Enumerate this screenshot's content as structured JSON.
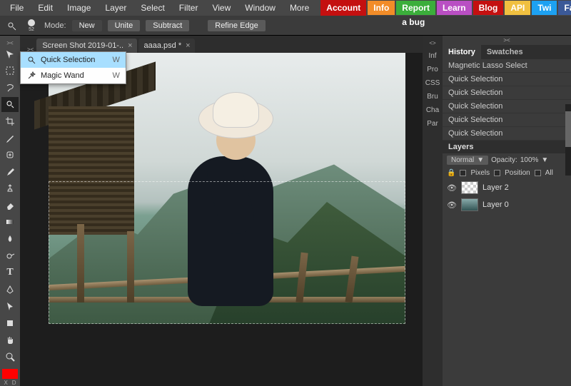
{
  "menubar": {
    "items": [
      "File",
      "Edit",
      "Image",
      "Layer",
      "Select",
      "Filter",
      "View",
      "Window",
      "More"
    ],
    "account": "Account"
  },
  "pills": {
    "info": "Info",
    "bug": "Report a bug",
    "learn": "Learn",
    "blog": "Blog",
    "api": "API",
    "twi": "Twi",
    "fb": "Facebook"
  },
  "options": {
    "brush_size": "52",
    "mode": "Mode:",
    "new": "New",
    "unite": "Unite",
    "subtract": "Subtract",
    "refine": "Refine Edge"
  },
  "tabs": {
    "t1": "Screen Shot 2019-01-..",
    "t2": "aaaa.psd *"
  },
  "flyout": {
    "opt1": "Quick Selection",
    "opt2": "Magic Wand",
    "k": "W"
  },
  "midtabs": {
    "t1": "Inf",
    "t2": "Pro",
    "t3": "CSS",
    "t4": "Bru",
    "t5": "Cha",
    "t6": "Par"
  },
  "rpanel": {
    "tab_history": "History",
    "tab_swatches": "Swatches",
    "hist": [
      "Magnetic Lasso Select",
      "Quick Selection",
      "Quick Selection",
      "Quick Selection",
      "Quick Selection",
      "Quick Selection"
    ],
    "layers_label": "Layers",
    "blend": "Normal",
    "opacity_label": "Opacity:",
    "opacity_val": "100%",
    "lock_pixels": "Pixels",
    "lock_position": "Position",
    "lock_all": "All",
    "layer1_name": "Layer 2",
    "layer0_name": "Layer 0"
  },
  "swap": {
    "x": "X",
    "d": "D"
  }
}
